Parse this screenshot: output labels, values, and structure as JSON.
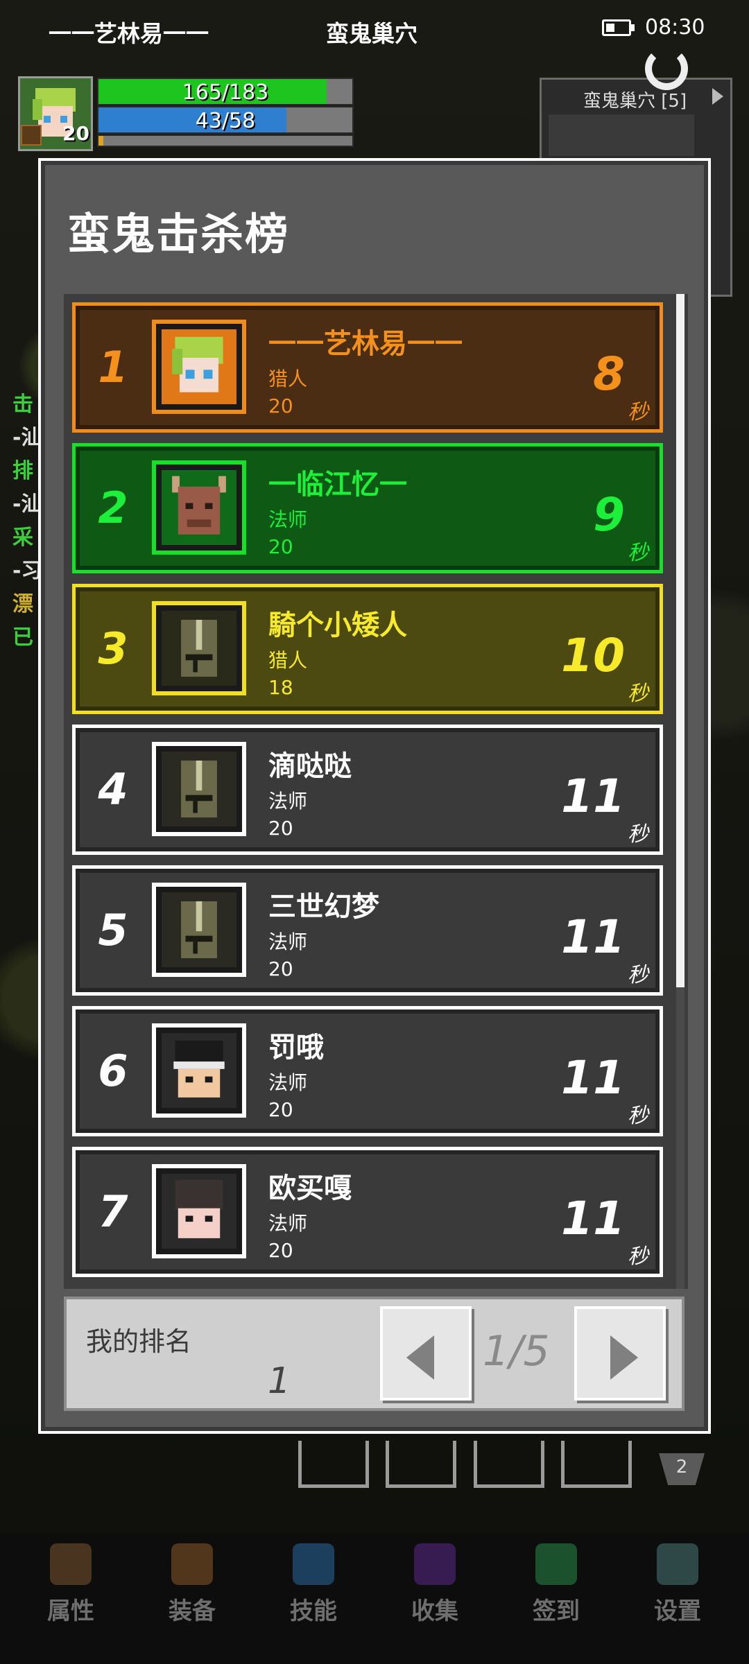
{
  "status": {
    "player_title": "一一艺林易一一",
    "area": "蛮鬼巢穴",
    "time": "08:30"
  },
  "player": {
    "level": "20",
    "hp": "165/183",
    "hp_fraction": 0.9,
    "mp": "43/58",
    "mp_fraction": 0.74,
    "xp_fraction": 0.02
  },
  "side_panel": {
    "title": "蛮鬼巢穴 [5]"
  },
  "left_hints": [
    "击",
    "-汕",
    "排",
    "-汕",
    "采",
    "-习",
    "漂",
    "已"
  ],
  "modal": {
    "title": "蛮鬼击杀榜",
    "rows": [
      {
        "rank": "1",
        "name": "一一艺林易一一",
        "class": "猎人",
        "level": "20",
        "time": "8",
        "unit": "秒",
        "avatar": "elf-avatar-icon"
      },
      {
        "rank": "2",
        "name": "一临江忆一",
        "class": "法师",
        "level": "20",
        "time": "9",
        "unit": "秒",
        "avatar": "minotaur-avatar-icon"
      },
      {
        "rank": "3",
        "name": "騎个小矮人",
        "class": "猎人",
        "level": "18",
        "time": "10",
        "unit": "秒",
        "avatar": "knight-helmet-icon"
      },
      {
        "rank": "4",
        "name": "滴哒哒",
        "class": "法师",
        "level": "20",
        "time": "11",
        "unit": "秒",
        "avatar": "knight-helmet-icon"
      },
      {
        "rank": "5",
        "name": "三世幻梦",
        "class": "法师",
        "level": "20",
        "time": "11",
        "unit": "秒",
        "avatar": "knight-helmet-icon"
      },
      {
        "rank": "6",
        "name": "罚哦",
        "class": "法师",
        "level": "20",
        "time": "11",
        "unit": "秒",
        "avatar": "headband-avatar-icon"
      },
      {
        "rank": "7",
        "name": "欧买嘎",
        "class": "法师",
        "level": "20",
        "time": "11",
        "unit": "秒",
        "avatar": "helmet-boy-avatar-icon"
      }
    ],
    "my_rank_label": "我的排名",
    "my_rank_value": "1",
    "page": "1/5"
  },
  "badge_count": "2",
  "nav": [
    {
      "label": "属性",
      "icon": "helmet-icon",
      "color": "#7a5530"
    },
    {
      "label": "装备",
      "icon": "bag-icon",
      "color": "#8a5a2a"
    },
    {
      "label": "技能",
      "icon": "skill-gem-icon",
      "color": "#2a6aa0"
    },
    {
      "label": "收集",
      "icon": "book-icon",
      "color": "#5a2a8a"
    },
    {
      "label": "签到",
      "icon": "emerald-icon",
      "color": "#2a8a4a"
    },
    {
      "label": "设置",
      "icon": "gear-icon",
      "color": "#4a7a7a"
    }
  ],
  "theme": {
    "gold": {
      "bg": "#4a2d12",
      "border": "#f08c18",
      "text": "#f4901c"
    },
    "green": {
      "bg": "#0e5a14",
      "border": "#18e02a",
      "text": "#1cf03a"
    },
    "yellow": {
      "bg": "#4c4a10",
      "border": "#f2e020",
      "text": "#f7ea28"
    },
    "gray": {
      "bg": "#3a3a3a",
      "border": "#ffffff",
      "text": "#ffffff"
    }
  }
}
